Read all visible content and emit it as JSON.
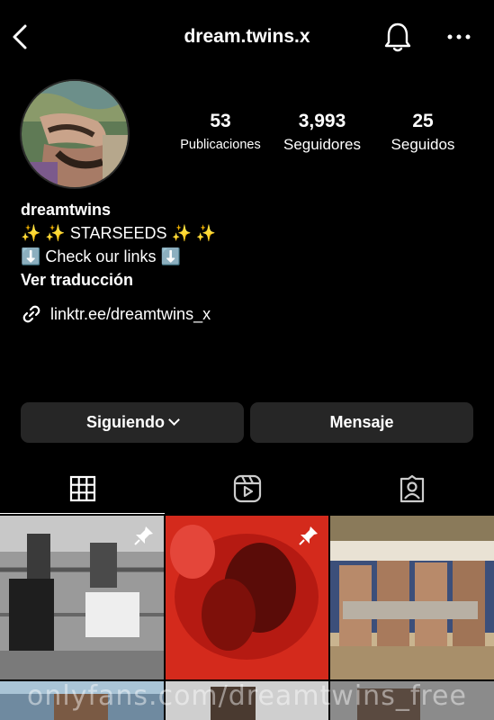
{
  "header": {
    "username": "dream.twins.x",
    "back_icon": "chevron-left-icon",
    "notification_icon": "bell-icon",
    "more_icon": "more-horizontal-icon"
  },
  "profile": {
    "stats": [
      {
        "value": "53",
        "label": "Publicaciones"
      },
      {
        "value": "3,993",
        "label": "Seguidores"
      },
      {
        "value": "25",
        "label": "Seguidos"
      }
    ],
    "display_name": "dreamtwins",
    "bio_lines": [
      "✨ ✨ STARSEEDS ✨ ✨",
      "⬇️ Check our links ⬇️"
    ],
    "translate_label": "Ver traducción",
    "link": "linktr.ee/dreamtwins_x"
  },
  "actions": {
    "following_label": "Siguiendo",
    "message_label": "Mensaje"
  },
  "tabs": [
    {
      "icon": "grid-icon",
      "active": true
    },
    {
      "icon": "reels-icon",
      "active": false
    },
    {
      "icon": "tagged-icon",
      "active": false
    }
  ],
  "watermark": "onlyfans.com/dreamtwins_free",
  "colors": {
    "background": "#000000",
    "button": "#262626",
    "text": "#ffffff"
  }
}
